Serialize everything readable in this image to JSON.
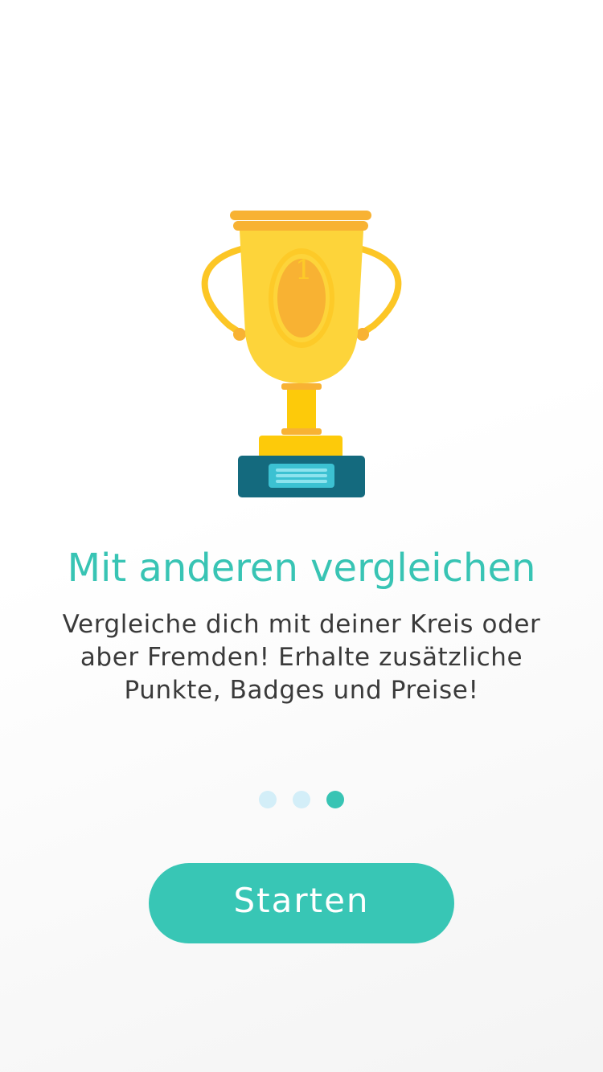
{
  "onboarding": {
    "title": "Mit anderen vergleichen",
    "description": "Vergleiche dich mit deiner Kreis oder aber Fremden! Erhalte zusätzliche Punkte, Badges und Preise!",
    "illustration": "trophy-icon",
    "trophy_badge_number": "1",
    "page_indicator": {
      "total": 3,
      "active_index": 2
    },
    "start_label": "Starten"
  },
  "colors": {
    "accent": "#38c4b4",
    "dot_inactive": "#d3eef8",
    "text": "#3a3a3a",
    "trophy_gold": "#fdd43a",
    "trophy_dark_gold": "#f8b233",
    "trophy_base": "#146a7e",
    "trophy_plaque": "#3cc1d2"
  }
}
